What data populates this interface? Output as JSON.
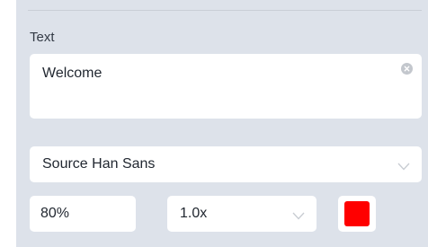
{
  "text_section": {
    "label": "Text",
    "value": "Welcome"
  },
  "font_select": {
    "value": "Source Han Sans"
  },
  "size_input": {
    "value": "80%"
  },
  "scale_select": {
    "value": "1.0x"
  },
  "color_picker": {
    "color": "#ff0000"
  },
  "icons": {
    "clear": "clear-icon",
    "chevron": "chevron-down-icon"
  }
}
